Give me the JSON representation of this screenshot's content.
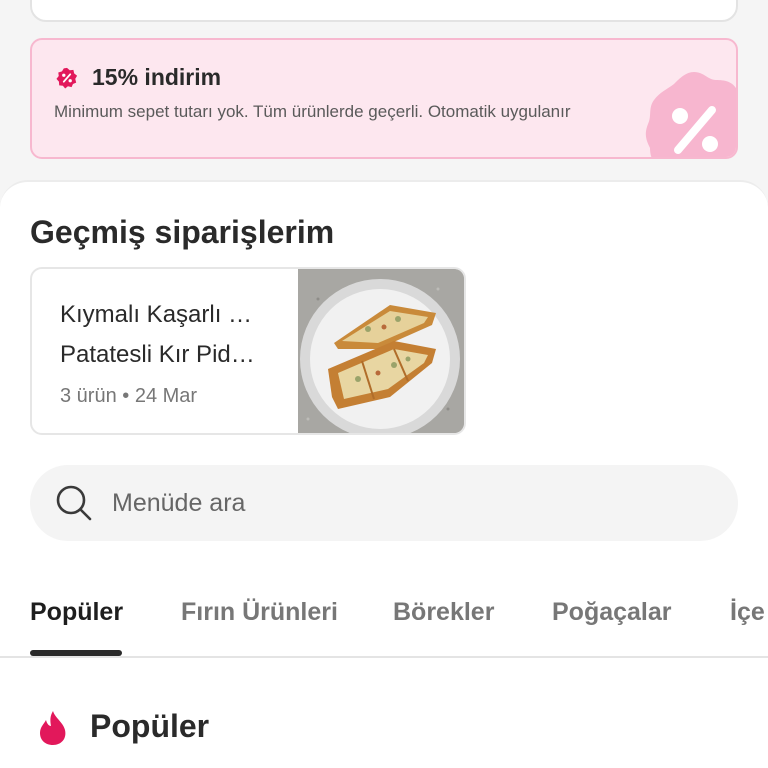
{
  "promo": {
    "title": "15% indirim",
    "description": "Minimum sepet tutarı yok. Tüm ürünlerde geçerli. Otomatik uygulanır"
  },
  "past_orders": {
    "title": "Geçmiş siparişlerim",
    "orders": [
      {
        "items": [
          "Kıymalı Kaşarlı …",
          "Patatesli Kır Pid…"
        ],
        "meta": "3 ürün • 24 Mar"
      }
    ]
  },
  "search": {
    "placeholder": "Menüde ara"
  },
  "tabs": [
    {
      "label": "Popüler",
      "active": true
    },
    {
      "label": "Fırın Ürünleri",
      "active": false
    },
    {
      "label": "Börekler",
      "active": false
    },
    {
      "label": "Poğaçalar",
      "active": false
    },
    {
      "label": "İçe",
      "active": false
    }
  ],
  "popular_section": {
    "title": "Popüler"
  },
  "colors": {
    "accent": "#e2185b",
    "promo_bg": "#fde7ef",
    "promo_border": "#f7b8cf",
    "promo_art": "#f7b6cf"
  },
  "icons": {
    "promo_badge": "discount-badge-icon",
    "search": "search-icon",
    "popular": "flame-icon",
    "promo_art": "percent-burst-icon"
  }
}
